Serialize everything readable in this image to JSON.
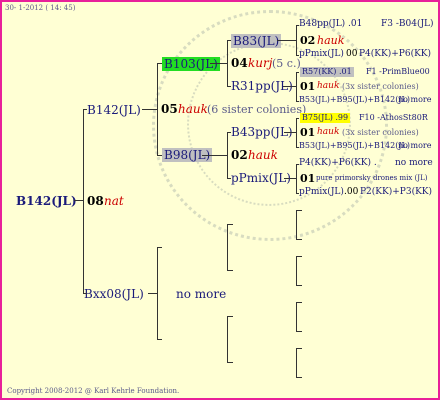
{
  "header": {
    "date": "30- 1-2012 ( 14: 45)"
  },
  "footer": {
    "copyright": "Copyright 2008-2012 @ Karl Kehrle Foundation."
  },
  "root": {
    "name": "B142(JL)",
    "year": "08",
    "breeder": "nat"
  },
  "gen1": {
    "top": {
      "name": "B142(JL)",
      "year": "05",
      "breeder": "hauk",
      "note": "(6 sister colonies)"
    },
    "bottom": {
      "name": "Bxx08(JL)",
      "note": "no more"
    }
  },
  "gen2": {
    "a": {
      "name": "B103(JL)",
      "year": "04",
      "breeder": "kurj",
      "note": "(5 c.)"
    },
    "b": {
      "name": "B98(JL)",
      "year": "02",
      "breeder": "hauk"
    }
  },
  "gen3": {
    "a1": {
      "name": "B83(JL)",
      "year": "02",
      "breeder": "hauk"
    },
    "a2": {
      "name": "R31pp(JL)",
      "year": "01",
      "breeder": "hauk",
      "note": "(3x sister colonies)"
    },
    "b1": {
      "name": "B43pp(JL)",
      "year": "01",
      "breeder": "hauk",
      "note": "(3x sister colonies)"
    },
    "b2": {
      "name": "pPmix(JL)",
      "year": "01",
      "note": "pure primorsky drones mix (JL)"
    }
  },
  "gen4": {
    "r1": {
      "left": "B48pp(JL) .01",
      "right": "F3 -B04(JL)"
    },
    "r2a": "pPmix(JL)",
    "r2b": "00",
    "r2c": "P4(KK)+P6(KK)",
    "r3": {
      "left": "R57(KK) .01",
      "right": "F1 -PrimBlue00"
    },
    "r4a": "B53(JL)+B95(JL)+B142(JL)",
    "r4b": "no more",
    "r5": {
      "left": "B75(JL) .99",
      "right": "F10 -AthosSt80R"
    },
    "r6a": "B53(JL)+B95(JL)+B142(JL)",
    "r6b": "no more",
    "r7a": "P4(KK)+P6(KK) .",
    "r7b": "no more",
    "r8a": "pPmix(JL)",
    "r8b": ".00",
    "r8c": "P2(KK)+P3(KK)"
  },
  "colors": {
    "border": "#e8209a",
    "background": "#ffffd4",
    "green_box": "#22dd22",
    "yellow_box": "#ffff00",
    "gray_box": "#c0c0c0",
    "text": "#1a1a7a",
    "breeder": "#cc0000"
  }
}
